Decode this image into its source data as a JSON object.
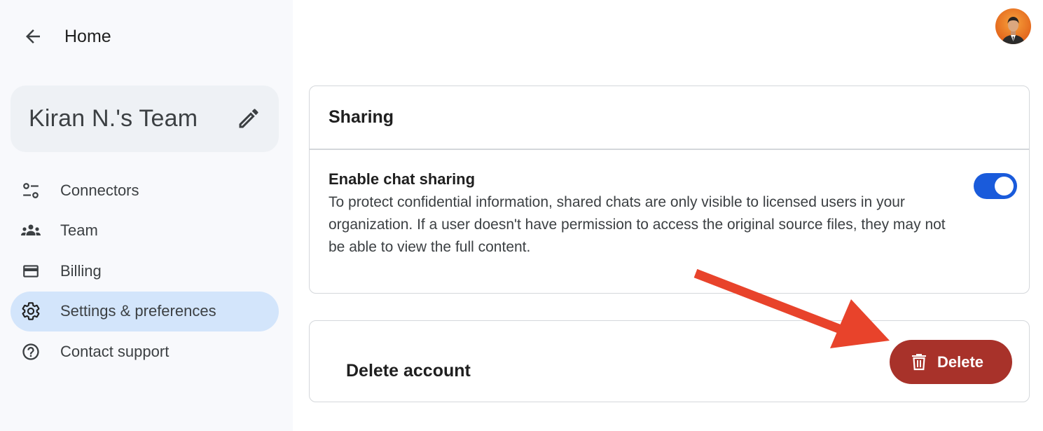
{
  "sidebar": {
    "home_label": "Home",
    "team_name": "Kiran N.'s Team",
    "items": [
      {
        "label": "Connectors",
        "icon": "connectors-icon"
      },
      {
        "label": "Team",
        "icon": "team-icon"
      },
      {
        "label": "Billing",
        "icon": "credit-card-icon"
      },
      {
        "label": "Settings & preferences",
        "icon": "gear-icon",
        "active": true
      },
      {
        "label": "Contact support",
        "icon": "help-icon"
      }
    ]
  },
  "sharing": {
    "title": "Sharing",
    "setting_title": "Enable chat sharing",
    "setting_desc": "To protect confidential information, shared chats are only visible to licensed users in your organization. If a user doesn't have permission to access the original source files, they may not be able to view the full content.",
    "enabled": true
  },
  "delete_section": {
    "title": "Delete account",
    "button_label": "Delete"
  },
  "colors": {
    "toggle_on": "#1a5bdb",
    "delete_button": "#a8322a",
    "active_nav": "#d3e5fb",
    "annotation_arrow": "#e8432b"
  }
}
